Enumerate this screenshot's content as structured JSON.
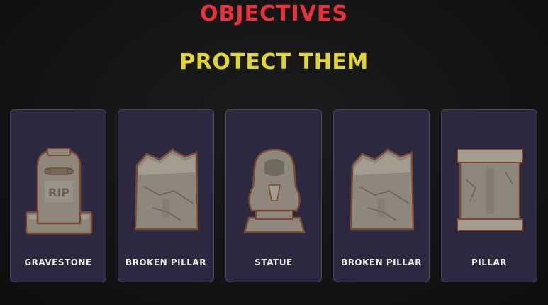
{
  "title": "OBJECTIVES",
  "subtitle": "PROTECT THEM",
  "colors": {
    "title": "#e8313a",
    "subtitle": "#e2d52c",
    "card_bg": "#2c2840",
    "card_border": "#4a4560",
    "stone": "#8e887c",
    "stone_outline": "#7a4a34"
  },
  "cards": [
    {
      "label": "GRAVESTONE",
      "icon": "gravestone-icon",
      "engraving": "RIP"
    },
    {
      "label": "BROKEN PILLAR",
      "icon": "broken-pillar-icon"
    },
    {
      "label": "STATUE",
      "icon": "statue-icon"
    },
    {
      "label": "BROKEN PILLAR",
      "icon": "broken-pillar-icon"
    },
    {
      "label": "PILLAR",
      "icon": "pillar-icon"
    }
  ]
}
